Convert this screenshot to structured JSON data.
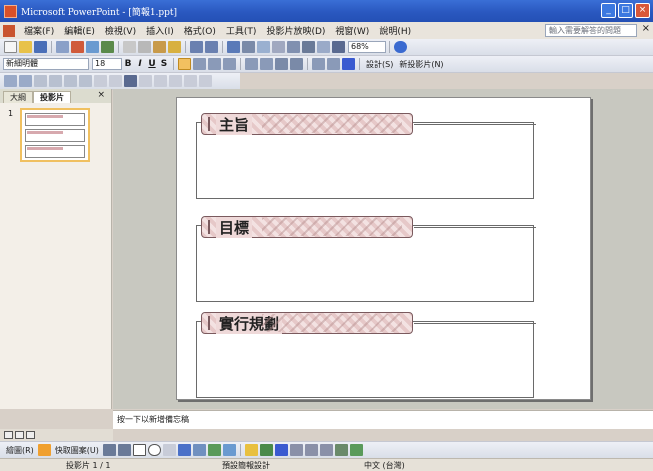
{
  "window": {
    "title": "Microsoft PowerPoint - [簡報1.ppt]",
    "minimize": "_",
    "restore": "□",
    "close": "×"
  },
  "menu": {
    "items": [
      "檔案(F)",
      "編輯(E)",
      "檢視(V)",
      "插入(I)",
      "格式(O)",
      "工具(T)",
      "投影片放映(D)",
      "視窗(W)",
      "說明(H)"
    ],
    "help_placeholder": "輸入需要解答的問題",
    "close": "×"
  },
  "toolbar": {
    "zoom": "68%"
  },
  "format_toolbar": {
    "font": "新細明體",
    "size": "18",
    "bold": "B",
    "italic": "I",
    "underline": "U",
    "shadow": "S",
    "design": "設計(S)",
    "new_slide": "新投影片(N)"
  },
  "panel": {
    "tabs": [
      "大綱",
      "投影片"
    ],
    "close": "×",
    "slide_number": "1"
  },
  "slide": {
    "sections": [
      {
        "heading": "主旨"
      },
      {
        "heading": "目標"
      },
      {
        "heading": "實行規劃"
      }
    ]
  },
  "notes": {
    "placeholder": "按一下以新增備忘稿"
  },
  "drawing_toolbar": {
    "draw": "繪圖(R)",
    "autoshapes": "快取圖案(U)"
  },
  "status": {
    "slide": "投影片 1 / 1",
    "design": "預設簡報設計",
    "language": "中文 (台灣)"
  },
  "colors": {
    "title_bar": "#2a58c0",
    "band": "#e6c8c8",
    "band_border": "#7a5a5e"
  }
}
